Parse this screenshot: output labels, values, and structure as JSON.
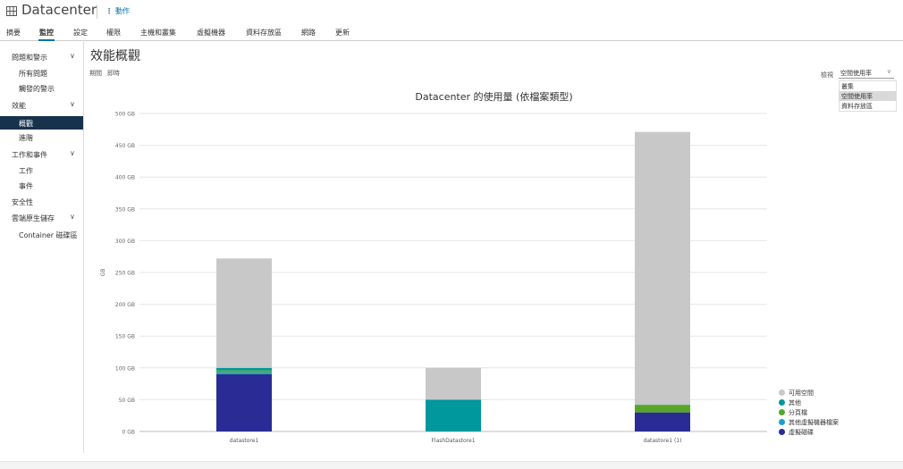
{
  "header": {
    "title": "Datacenter",
    "actions_label": "動作"
  },
  "tabs": [
    "摘要",
    "監控",
    "設定",
    "權限",
    "主機和叢集",
    "虛擬機器",
    "資料存放區",
    "網路",
    "更新"
  ],
  "sidebar": {
    "issues_group": "問題和警示",
    "all_issues": "所有問題",
    "triggered_alarms": "觸發的警示",
    "performance_group": "效能",
    "overview": "概觀",
    "advanced": "進階",
    "tasks_group": "工作和事件",
    "tasks": "工作",
    "events": "事件",
    "security": "安全性",
    "cloud_native_group": "雲端原生儲存",
    "container_volumes": "Container 磁碟區"
  },
  "main": {
    "page_title": "效能概觀",
    "period_label": "期間",
    "period_value": "即時",
    "view_label": "檢視",
    "view_value": "空間使用率",
    "view_options": [
      "叢集",
      "空間使用率",
      "資料存放區"
    ]
  },
  "colors": {
    "free": "#c8c8c8",
    "other": "#00979d",
    "swap": "#57a62a",
    "other_vm": "#1aa0c6",
    "vdisk": "#2b2b95"
  },
  "chart_data": {
    "type": "bar",
    "stacked": true,
    "title": "Datacenter 的使用量 (依檔案類型)",
    "ylabel": "GB",
    "ylim": [
      0,
      500
    ],
    "y_ticks": [
      "0 GB",
      "50 GB",
      "100 GB",
      "150 GB",
      "200 GB",
      "250 GB",
      "300 GB",
      "350 GB",
      "400 GB",
      "450 GB",
      "500 GB"
    ],
    "categories": [
      "datastore1",
      "FlashDatastore1",
      "datastore1 (1)"
    ],
    "series": [
      {
        "name": "虛擬磁碟",
        "color": "#2b2b95",
        "values": [
          90,
          0,
          30
        ]
      },
      {
        "name": "其他虛擬機器檔案",
        "color": "#1aa0c6",
        "values": [
          3,
          0,
          0
        ]
      },
      {
        "name": "分頁檔",
        "color": "#57a62a",
        "values": [
          3,
          0,
          12
        ]
      },
      {
        "name": "其他",
        "color": "#00979d",
        "values": [
          4,
          50,
          0
        ]
      },
      {
        "name": "可用空間",
        "color": "#c8c8c8",
        "values": [
          172,
          50,
          429
        ]
      }
    ],
    "legend": [
      "可用空間",
      "其他",
      "分頁檔",
      "其他虛擬機器檔案",
      "虛擬磁碟"
    ],
    "legend_position": "bottom-right",
    "grid": true
  }
}
